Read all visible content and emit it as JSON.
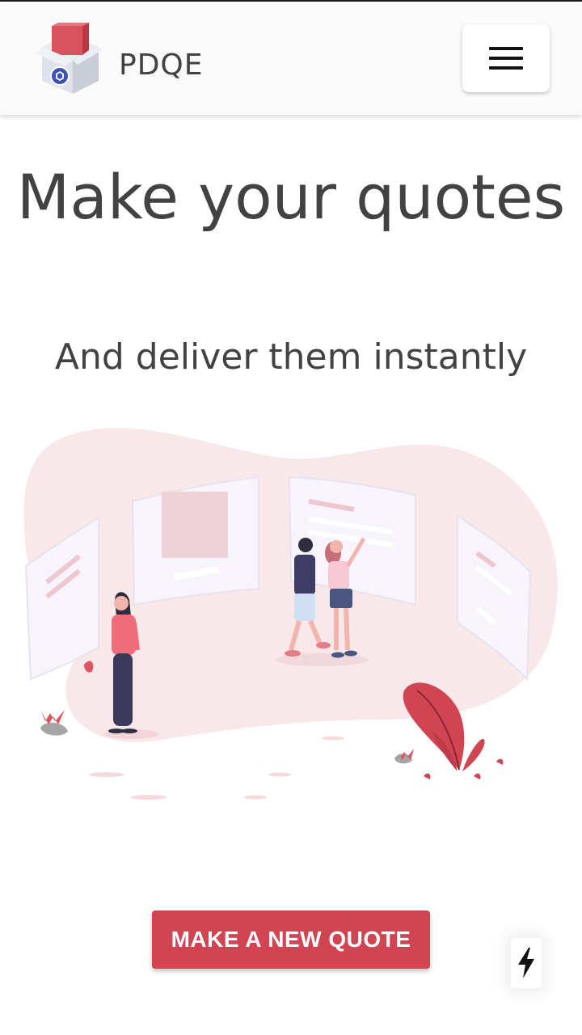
{
  "header": {
    "brand": "PDQE",
    "logo_icon": "package-box-icon",
    "menu_icon": "hamburger-menu-icon"
  },
  "hero": {
    "title": "Make your quotes",
    "subtitle": "And deliver them instantly"
  },
  "illustration": {
    "icon": "people-browsing-quotes-illustration"
  },
  "cta": {
    "label": "MAKE A NEW QUOTE"
  },
  "fab": {
    "icon": "lightning-bolt-icon"
  },
  "colors": {
    "accent": "#d14553",
    "text": "#424242",
    "header_bg": "#fafafa",
    "blob": "#f8e8ea"
  }
}
